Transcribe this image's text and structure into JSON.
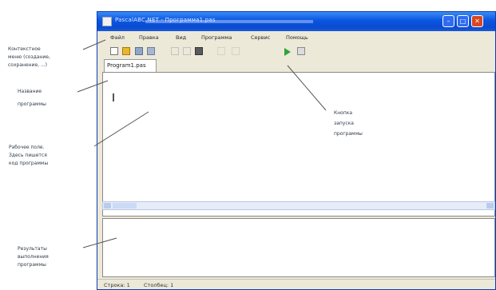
{
  "annotations": {
    "context_menu": [
      "Контекстное",
      "меню (создание,",
      "сохранение, ...)"
    ],
    "program_name": [
      "Название",
      "программы"
    ],
    "work_area": [
      "Рабочее поле.",
      "Здесь пишется",
      "код программы"
    ],
    "run_button": [
      "Кнопка",
      "запуска",
      "программы"
    ],
    "results": [
      "Результаты",
      "выполнения",
      "программы"
    ]
  },
  "window": {
    "title": "PascalABC.NET - Программа1.pas"
  },
  "menu": [
    "Файл",
    "Правка",
    "Вид",
    "Программа",
    "Сервис",
    "Помощь"
  ],
  "toolbar": {
    "icons": [
      "new-file-icon",
      "open-folder-icon",
      "save-icon",
      "save-all-icon",
      "cut-icon",
      "copy-icon",
      "paste-icon",
      "undo-icon",
      "redo-icon",
      "run-icon",
      "stop-icon"
    ]
  },
  "tab": {
    "label": "Program1.pas"
  },
  "status": {
    "line": "Строка: 1",
    "column": "Столбец: 1"
  },
  "colors": {
    "titlebar": "#0a55e0",
    "window_bg": "#ece9d8",
    "run_green": "#2fa43a",
    "close_red": "#d9471f"
  }
}
